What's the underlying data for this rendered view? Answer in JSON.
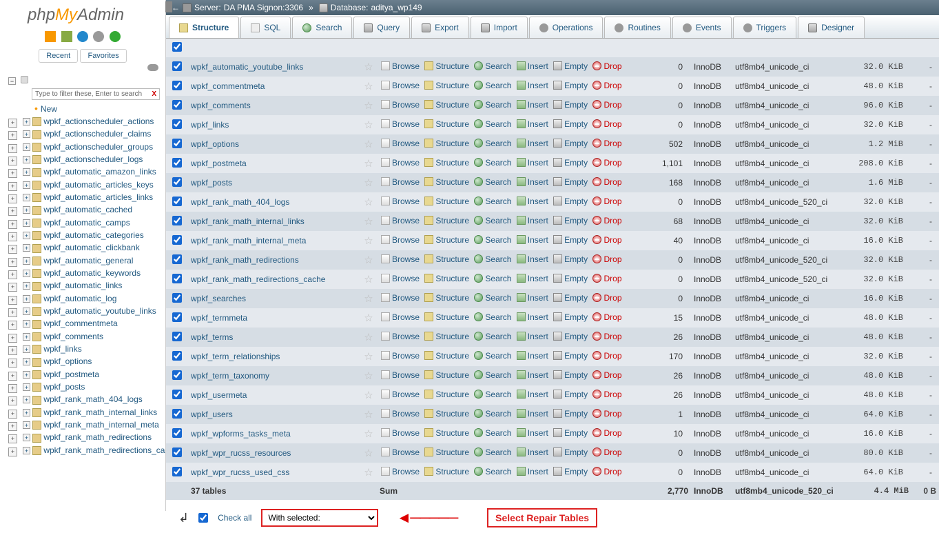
{
  "logo": {
    "php": "php",
    "my": "My",
    "admin": "Admin"
  },
  "recent_label": "Recent",
  "favorites_label": "Favorites",
  "filter_placeholder": "Type to filter these, Enter to search",
  "new_label": "New",
  "sidebar_tables": [
    "wpkf_actionscheduler_actions",
    "wpkf_actionscheduler_claims",
    "wpkf_actionscheduler_groups",
    "wpkf_actionscheduler_logs",
    "wpkf_automatic_amazon_links",
    "wpkf_automatic_articles_keys",
    "wpkf_automatic_articles_links",
    "wpkf_automatic_cached",
    "wpkf_automatic_camps",
    "wpkf_automatic_categories",
    "wpkf_automatic_clickbank",
    "wpkf_automatic_general",
    "wpkf_automatic_keywords",
    "wpkf_automatic_links",
    "wpkf_automatic_log",
    "wpkf_automatic_youtube_links",
    "wpkf_commentmeta",
    "wpkf_comments",
    "wpkf_links",
    "wpkf_options",
    "wpkf_postmeta",
    "wpkf_posts",
    "wpkf_rank_math_404_logs",
    "wpkf_rank_math_internal_links",
    "wpkf_rank_math_internal_meta",
    "wpkf_rank_math_redirections",
    "wpkf_rank_math_redirections_cache"
  ],
  "breadcrumb": {
    "server_label": "Server:",
    "server_value": "DA PMA Signon:3306",
    "db_label": "Database:",
    "db_value": "aditya_wp149"
  },
  "tabs": [
    {
      "label": "Structure",
      "active": true
    },
    {
      "label": "SQL"
    },
    {
      "label": "Search"
    },
    {
      "label": "Query"
    },
    {
      "label": "Export"
    },
    {
      "label": "Import"
    },
    {
      "label": "Operations"
    },
    {
      "label": "Routines"
    },
    {
      "label": "Events"
    },
    {
      "label": "Triggers"
    },
    {
      "label": "Designer"
    }
  ],
  "actions": {
    "browse": "Browse",
    "structure": "Structure",
    "search": "Search",
    "insert": "Insert",
    "empty": "Empty",
    "drop": "Drop"
  },
  "rows": [
    {
      "name": "wpkf_automatic_youtube_links",
      "count": "0",
      "engine": "InnoDB",
      "collation": "utf8mb4_unicode_ci",
      "size": "32.0 KiB",
      "ovh": "-",
      "cls": "even"
    },
    {
      "name": "wpkf_commentmeta",
      "count": "0",
      "engine": "InnoDB",
      "collation": "utf8mb4_unicode_ci",
      "size": "48.0 KiB",
      "ovh": "-",
      "cls": "odd"
    },
    {
      "name": "wpkf_comments",
      "count": "0",
      "engine": "InnoDB",
      "collation": "utf8mb4_unicode_ci",
      "size": "96.0 KiB",
      "ovh": "-",
      "cls": "even"
    },
    {
      "name": "wpkf_links",
      "count": "0",
      "engine": "InnoDB",
      "collation": "utf8mb4_unicode_ci",
      "size": "32.0 KiB",
      "ovh": "-",
      "cls": "odd"
    },
    {
      "name": "wpkf_options",
      "count": "502",
      "engine": "InnoDB",
      "collation": "utf8mb4_unicode_ci",
      "size": "1.2 MiB",
      "ovh": "-",
      "cls": "even"
    },
    {
      "name": "wpkf_postmeta",
      "count": "1,101",
      "engine": "InnoDB",
      "collation": "utf8mb4_unicode_ci",
      "size": "208.0 KiB",
      "ovh": "-",
      "cls": "odd"
    },
    {
      "name": "wpkf_posts",
      "count": "168",
      "engine": "InnoDB",
      "collation": "utf8mb4_unicode_ci",
      "size": "1.6 MiB",
      "ovh": "-",
      "cls": "even"
    },
    {
      "name": "wpkf_rank_math_404_logs",
      "count": "0",
      "engine": "InnoDB",
      "collation": "utf8mb4_unicode_520_ci",
      "size": "32.0 KiB",
      "ovh": "-",
      "cls": "odd"
    },
    {
      "name": "wpkf_rank_math_internal_links",
      "count": "68",
      "engine": "InnoDB",
      "collation": "utf8mb4_unicode_ci",
      "size": "32.0 KiB",
      "ovh": "-",
      "cls": "even"
    },
    {
      "name": "wpkf_rank_math_internal_meta",
      "count": "40",
      "engine": "InnoDB",
      "collation": "utf8mb4_unicode_ci",
      "size": "16.0 KiB",
      "ovh": "-",
      "cls": "odd"
    },
    {
      "name": "wpkf_rank_math_redirections",
      "count": "0",
      "engine": "InnoDB",
      "collation": "utf8mb4_unicode_520_ci",
      "size": "32.0 KiB",
      "ovh": "-",
      "cls": "even"
    },
    {
      "name": "wpkf_rank_math_redirections_cache",
      "count": "0",
      "engine": "InnoDB",
      "collation": "utf8mb4_unicode_520_ci",
      "size": "32.0 KiB",
      "ovh": "-",
      "cls": "odd"
    },
    {
      "name": "wpkf_searches",
      "count": "0",
      "engine": "InnoDB",
      "collation": "utf8mb4_unicode_ci",
      "size": "16.0 KiB",
      "ovh": "-",
      "cls": "even"
    },
    {
      "name": "wpkf_termmeta",
      "count": "15",
      "engine": "InnoDB",
      "collation": "utf8mb4_unicode_ci",
      "size": "48.0 KiB",
      "ovh": "-",
      "cls": "odd"
    },
    {
      "name": "wpkf_terms",
      "count": "26",
      "engine": "InnoDB",
      "collation": "utf8mb4_unicode_ci",
      "size": "48.0 KiB",
      "ovh": "-",
      "cls": "even"
    },
    {
      "name": "wpkf_term_relationships",
      "count": "170",
      "engine": "InnoDB",
      "collation": "utf8mb4_unicode_ci",
      "size": "32.0 KiB",
      "ovh": "-",
      "cls": "odd"
    },
    {
      "name": "wpkf_term_taxonomy",
      "count": "26",
      "engine": "InnoDB",
      "collation": "utf8mb4_unicode_ci",
      "size": "48.0 KiB",
      "ovh": "-",
      "cls": "even"
    },
    {
      "name": "wpkf_usermeta",
      "count": "26",
      "engine": "InnoDB",
      "collation": "utf8mb4_unicode_ci",
      "size": "48.0 KiB",
      "ovh": "-",
      "cls": "odd"
    },
    {
      "name": "wpkf_users",
      "count": "1",
      "engine": "InnoDB",
      "collation": "utf8mb4_unicode_ci",
      "size": "64.0 KiB",
      "ovh": "-",
      "cls": "even"
    },
    {
      "name": "wpkf_wpforms_tasks_meta",
      "count": "10",
      "engine": "InnoDB",
      "collation": "utf8mb4_unicode_ci",
      "size": "16.0 KiB",
      "ovh": "-",
      "cls": "odd"
    },
    {
      "name": "wpkf_wpr_rucss_resources",
      "count": "0",
      "engine": "InnoDB",
      "collation": "utf8mb4_unicode_ci",
      "size": "80.0 KiB",
      "ovh": "-",
      "cls": "even"
    },
    {
      "name": "wpkf_wpr_rucss_used_css",
      "count": "0",
      "engine": "InnoDB",
      "collation": "utf8mb4_unicode_ci",
      "size": "64.0 KiB",
      "ovh": "-",
      "cls": "odd"
    }
  ],
  "summary": {
    "tables": "37 tables",
    "sum": "Sum",
    "count": "2,770",
    "engine": "InnoDB",
    "collation": "utf8mb4_unicode_520_ci",
    "size": "4.4 MiB",
    "ovh": "0 B"
  },
  "check_all": "Check all",
  "with_selected": "With selected:",
  "annotation": "Select Repair Tables"
}
